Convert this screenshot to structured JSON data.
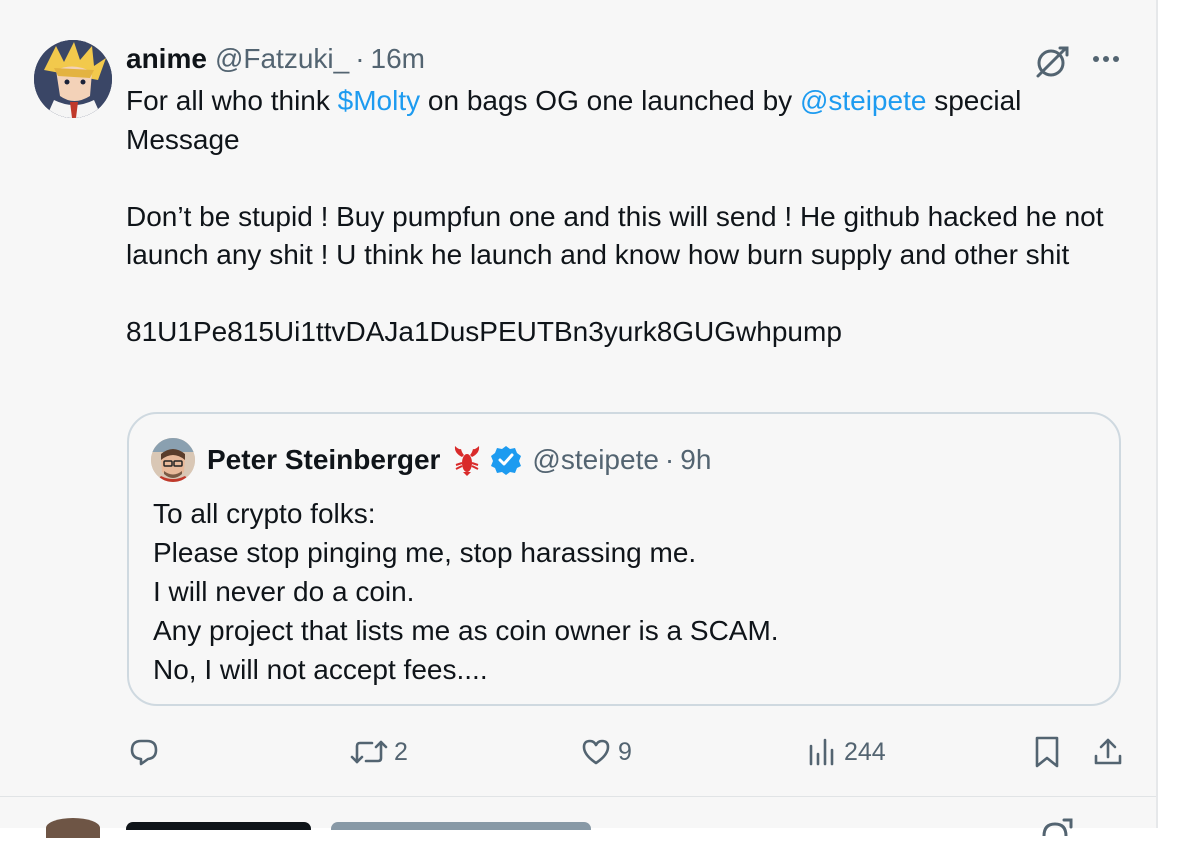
{
  "tweet": {
    "author_name": "anime",
    "author_handle": "@Fatzuki_",
    "separator": "·",
    "time": "16m",
    "text": {
      "line1_a": "For all who think ",
      "cashtag": "$Molty",
      "line1_b": " on bags OG one launched by ",
      "mention": "@steipete",
      "line1_c": " special Message",
      "para2": "Don’t be stupid ! Buy pumpfun one and this will send ! He github hacked he not launch any shit ! U think he launch and know how burn supply and other shit",
      "para3": "81U1Pe815Ui1ttvDAJa1DusPEUTBn3yurk8GUGwhpump"
    },
    "icons": {
      "grok": "grok-icon",
      "more": "more-icon"
    }
  },
  "quote": {
    "author_name": "Peter Steinberger",
    "name_emoji": "lobster-emoji",
    "verified": "verified-badge-icon",
    "author_handle": "@steipete",
    "separator": "·",
    "time": "9h",
    "lines": [
      "To all crypto folks:",
      "Please stop pinging me, stop harassing me.",
      "I will never do a coin.",
      "Any project that lists me as coin owner is a SCAM.",
      "No, I will not accept fees...."
    ]
  },
  "actions": {
    "reply": {
      "icon": "reply-icon",
      "count": ""
    },
    "repost": {
      "icon": "repost-icon",
      "count": "2"
    },
    "like": {
      "icon": "like-icon",
      "count": "9"
    },
    "views": {
      "icon": "views-icon",
      "count": "244"
    },
    "bookmark": {
      "icon": "bookmark-icon"
    },
    "share": {
      "icon": "share-icon"
    }
  },
  "colors": {
    "link": "#1d9bf0",
    "secondary_text": "#536471",
    "primary_text": "#0f1419",
    "background": "#f7f7f7",
    "verified": "#1d9bf0",
    "quote_border": "#cfd9e0"
  }
}
